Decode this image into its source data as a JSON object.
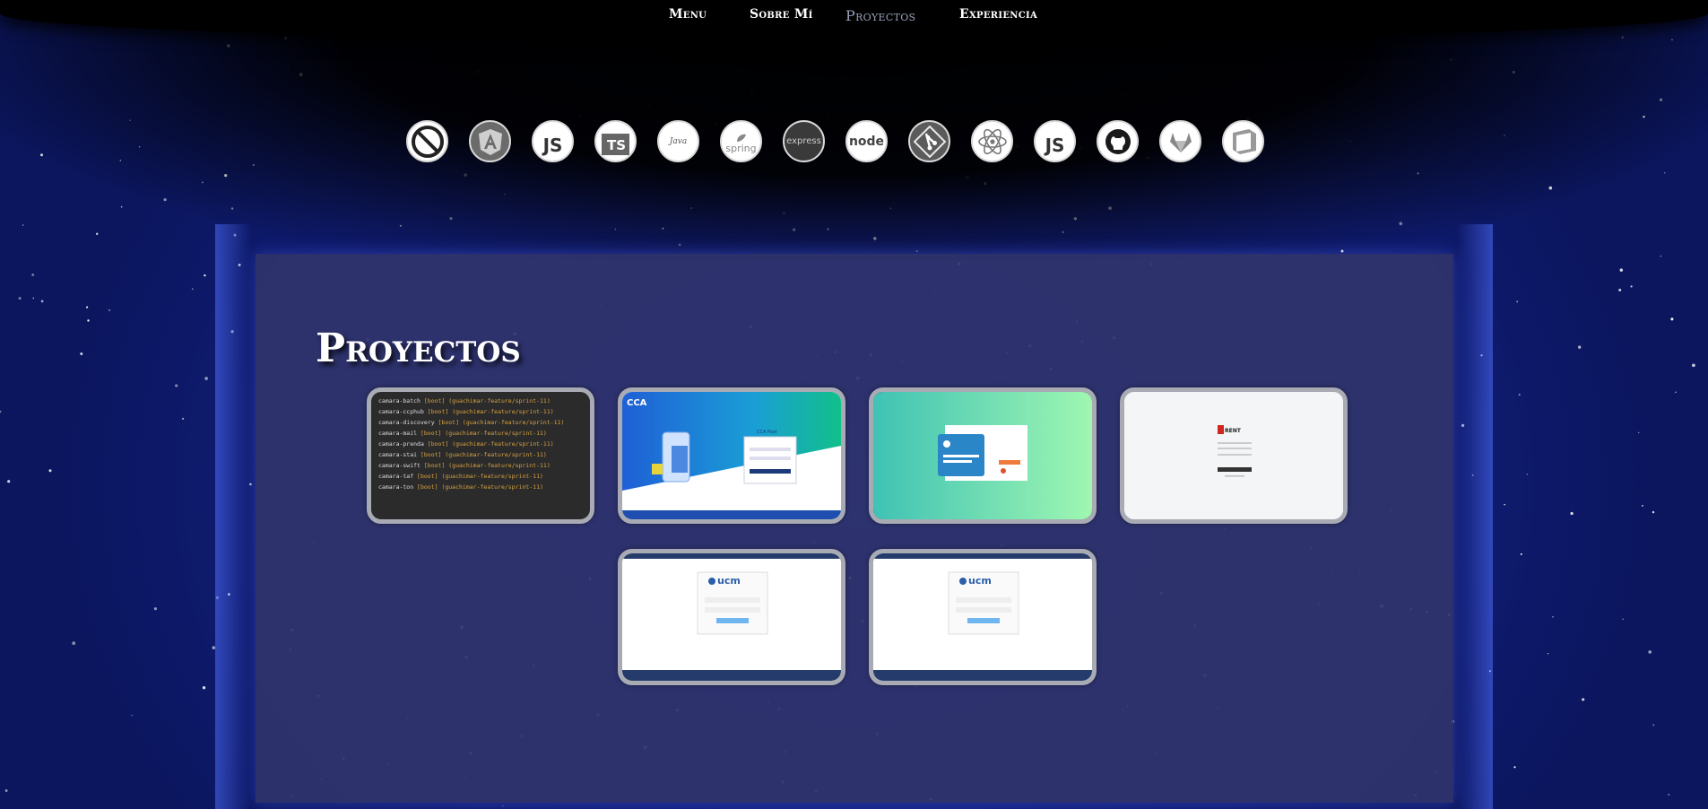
{
  "nav": {
    "items": [
      {
        "label": "Menu",
        "active": false
      },
      {
        "label": "Sobre Mí",
        "active": false
      },
      {
        "label": "Proyectos",
        "active": true
      },
      {
        "label": "Experiencia",
        "active": false
      }
    ]
  },
  "skills": [
    {
      "icon": "no-sign-icon"
    },
    {
      "icon": "angular-icon"
    },
    {
      "icon": "javascript-icon",
      "text": "JS"
    },
    {
      "icon": "typescript-icon",
      "text": "TS"
    },
    {
      "icon": "java-icon",
      "text": "Java"
    },
    {
      "icon": "spring-icon",
      "text": "spring"
    },
    {
      "icon": "express-icon",
      "text": "express"
    },
    {
      "icon": "nodejs-icon",
      "text": "node"
    },
    {
      "icon": "git-icon"
    },
    {
      "icon": "react-icon"
    },
    {
      "icon": "javascript-icon",
      "text": "JS"
    },
    {
      "icon": "github-icon"
    },
    {
      "icon": "gitlab-icon"
    },
    {
      "icon": "cube-icon"
    }
  ],
  "section": {
    "title": "Proyectos"
  },
  "projects": {
    "terminal": {
      "lines": [
        {
          "name": "camara-batch",
          "branch": "[boot] (guachimar-feature/sprint-11)"
        },
        {
          "name": "camara-ccphub",
          "branch": "[boot] (guachimar-feature/sprint-11)"
        },
        {
          "name": "camara-discovery",
          "branch": "[boot] (guachimar-feature/sprint-11)"
        },
        {
          "name": "camara-mail",
          "branch": "[boot] (guachimar-feature/sprint-11)"
        },
        {
          "name": "camara-prenda",
          "branch": "[boot] (guachimar-feature/sprint-11)"
        },
        {
          "name": "camara-stai",
          "branch": "[boot] (guachimar-feature/sprint-11)"
        },
        {
          "name": "camara-swift",
          "branch": "[boot] (guachimar-feature/sprint-11)"
        },
        {
          "name": "camara-taf",
          "branch": "[boot] (guachimar-feature/sprint-11)"
        },
        {
          "name": "camara-ton",
          "branch": "[boot] (guachimar-feature/sprint-11)"
        }
      ]
    },
    "cca": {
      "logo": "CCA",
      "card_title": "CCA Post"
    },
    "green": {},
    "rent": {
      "logo": "RENT"
    },
    "ucm1": {
      "logo": "ucm"
    },
    "ucm2": {
      "logo": "ucm"
    }
  },
  "colors": {
    "panel": "#2f346c",
    "nav_active": "#9aa0b8",
    "card_border": "#a9abb4"
  }
}
